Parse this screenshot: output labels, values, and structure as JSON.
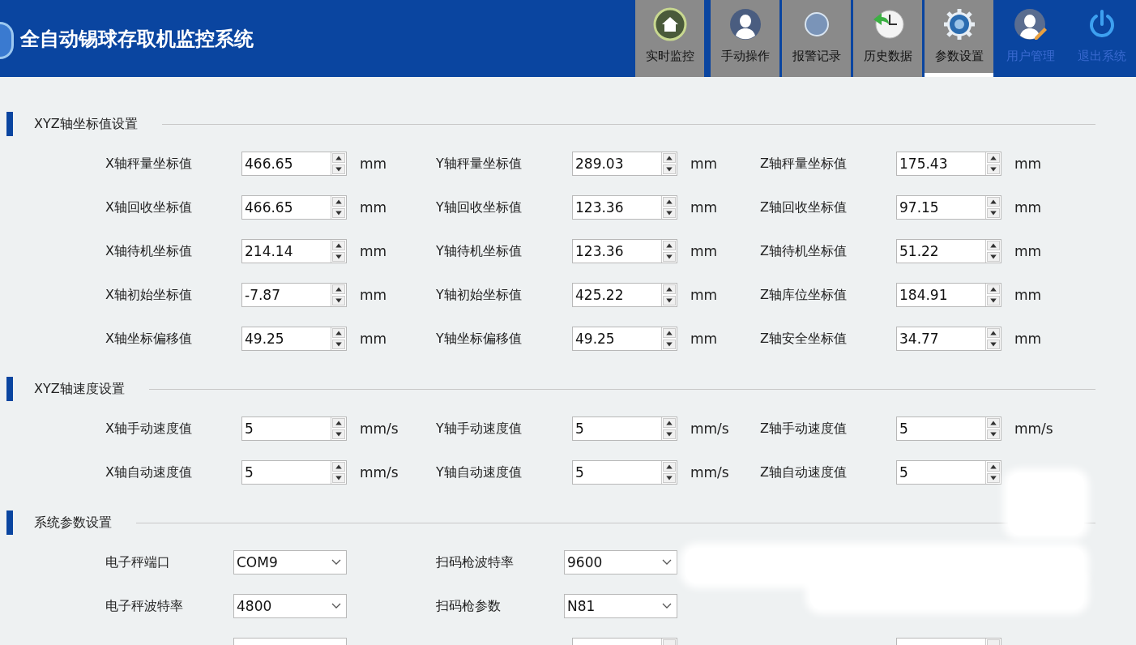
{
  "header": {
    "title": "全自动锡球存取机监控系统"
  },
  "nav": [
    {
      "label": "实时监控",
      "selected": false,
      "disabled": false
    },
    {
      "label": "手动操作",
      "selected": false,
      "disabled": false
    },
    {
      "label": "报警记录",
      "selected": false,
      "disabled": false
    },
    {
      "label": "历史数据",
      "selected": false,
      "disabled": false
    },
    {
      "label": "参数设置",
      "selected": true,
      "disabled": false
    },
    {
      "label": "用户管理",
      "selected": false,
      "disabled": true
    },
    {
      "label": "退出系统",
      "selected": false,
      "disabled": true
    }
  ],
  "sections": [
    {
      "title": "XYZ轴坐标值设置",
      "rows": [
        [
          {
            "kind": "spin",
            "label": "X轴秤量坐标值",
            "value": "466.65",
            "unit": "mm"
          },
          {
            "kind": "spin",
            "label": "Y轴秤量坐标值",
            "value": "289.03",
            "unit": "mm"
          },
          {
            "kind": "spin",
            "label": "Z轴秤量坐标值",
            "value": "175.43",
            "unit": "mm"
          }
        ],
        [
          {
            "kind": "spin",
            "label": "X轴回收坐标值",
            "value": "466.65",
            "unit": "mm"
          },
          {
            "kind": "spin",
            "label": "Y轴回收坐标值",
            "value": "123.36",
            "unit": "mm"
          },
          {
            "kind": "spin",
            "label": "Z轴回收坐标值",
            "value": "97.15",
            "unit": "mm"
          }
        ],
        [
          {
            "kind": "spin",
            "label": "X轴待机坐标值",
            "value": "214.14",
            "unit": "mm"
          },
          {
            "kind": "spin",
            "label": "Y轴待机坐标值",
            "value": "123.36",
            "unit": "mm"
          },
          {
            "kind": "spin",
            "label": "Z轴待机坐标值",
            "value": "51.22",
            "unit": "mm"
          }
        ],
        [
          {
            "kind": "spin",
            "label": "X轴初始坐标值",
            "value": "-7.87",
            "unit": "mm"
          },
          {
            "kind": "spin",
            "label": "Y轴初始坐标值",
            "value": "425.22",
            "unit": "mm"
          },
          {
            "kind": "spin",
            "label": "Z轴库位坐标值",
            "value": "184.91",
            "unit": "mm"
          }
        ],
        [
          {
            "kind": "spin",
            "label": "X轴坐标偏移值",
            "value": "49.25",
            "unit": "mm"
          },
          {
            "kind": "spin",
            "label": "Y轴坐标偏移值",
            "value": "49.25",
            "unit": "mm"
          },
          {
            "kind": "spin",
            "label": "Z轴安全坐标值",
            "value": "34.77",
            "unit": "mm"
          }
        ]
      ]
    },
    {
      "title": "XYZ轴速度设置",
      "rows": [
        [
          {
            "kind": "spin",
            "label": "X轴手动速度值",
            "value": "5",
            "unit": "mm/s"
          },
          {
            "kind": "spin",
            "label": "Y轴手动速度值",
            "value": "5",
            "unit": "mm/s"
          },
          {
            "kind": "spin",
            "label": "Z轴手动速度值",
            "value": "5",
            "unit": "mm/s"
          }
        ],
        [
          {
            "kind": "spin",
            "label": "X轴自动速度值",
            "value": "5",
            "unit": "mm/s"
          },
          {
            "kind": "spin",
            "label": "Y轴自动速度值",
            "value": "5",
            "unit": "mm/s"
          },
          {
            "kind": "spin",
            "label": "Z轴自动速度值",
            "value": "5"
          }
        ]
      ]
    },
    {
      "title": "系统参数设置",
      "rows": [
        [
          {
            "kind": "combo",
            "label": "电子秤端口",
            "value": "COM9"
          },
          {
            "kind": "combo",
            "label": "扫码枪波特率",
            "value": "9600"
          }
        ],
        [
          {
            "kind": "combo",
            "label": "电子秤波特率",
            "value": "4800"
          },
          {
            "kind": "combo",
            "label": "扫码枪参数",
            "value": "N81"
          }
        ],
        [
          {
            "kind": "combo"
          },
          {
            "kind": "spin"
          },
          {
            "kind": "spin"
          }
        ]
      ]
    }
  ]
}
